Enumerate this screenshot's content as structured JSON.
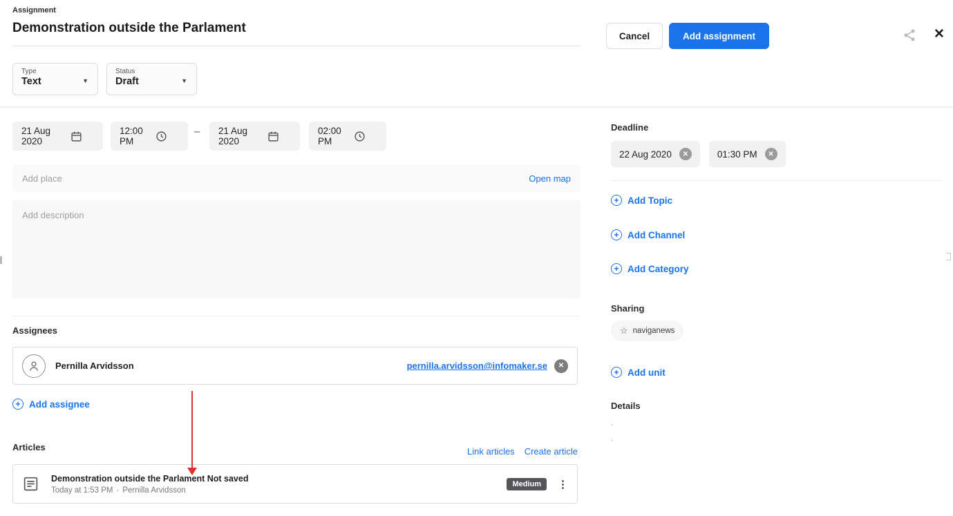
{
  "icons": {
    "caret_down": "▼",
    "close": "✕",
    "remove": "✕",
    "kebab": "⋮",
    "star": "☆",
    "plus": "+",
    "range_separator": "–",
    "meta_separator": "·"
  },
  "header": {
    "field_label": "Assignment",
    "title_value": "Demonstration outside the Parlament",
    "cancel_label": "Cancel",
    "submit_label": "Add assignment",
    "type_label": "Type",
    "type_value": "Text",
    "status_label": "Status",
    "status_value": "Draft"
  },
  "schedule": {
    "start_date": "21 Aug 2020",
    "start_time": "12:00 PM",
    "end_date": "21 Aug 2020",
    "end_time": "02:00 PM"
  },
  "place": {
    "placeholder": "Add place",
    "open_map_label": "Open map"
  },
  "description": {
    "placeholder": "Add description"
  },
  "assignees": {
    "heading": "Assignees",
    "items": [
      {
        "name": "Pernilla Arvidsson",
        "email": "pernilla.arvidsson@infomaker.se"
      }
    ],
    "add_label": "Add assignee"
  },
  "articles": {
    "heading": "Articles",
    "link_articles_label": "Link articles",
    "create_article_label": "Create article",
    "items": [
      {
        "title": "Demonstration outside the Parlament Not saved",
        "timestamp": "Today at 1:53 PM",
        "author": "Pernilla Arvidsson",
        "priority": "Medium"
      }
    ]
  },
  "deadline": {
    "heading": "Deadline",
    "date": "22 Aug 2020",
    "time": "01:30 PM"
  },
  "metadata_links": [
    {
      "label": "Add Topic"
    },
    {
      "label": "Add Channel"
    },
    {
      "label": "Add Category"
    }
  ],
  "sharing": {
    "heading": "Sharing",
    "unit_name": "naviganews",
    "add_unit_label": "Add unit"
  },
  "details": {
    "heading": "Details",
    "rows": [
      ".",
      "."
    ]
  },
  "colors": {
    "accent_blue": "#1a73e8",
    "priority_badge_bg": "#55565a",
    "annotation_arrow_red": "#e0312e"
  }
}
